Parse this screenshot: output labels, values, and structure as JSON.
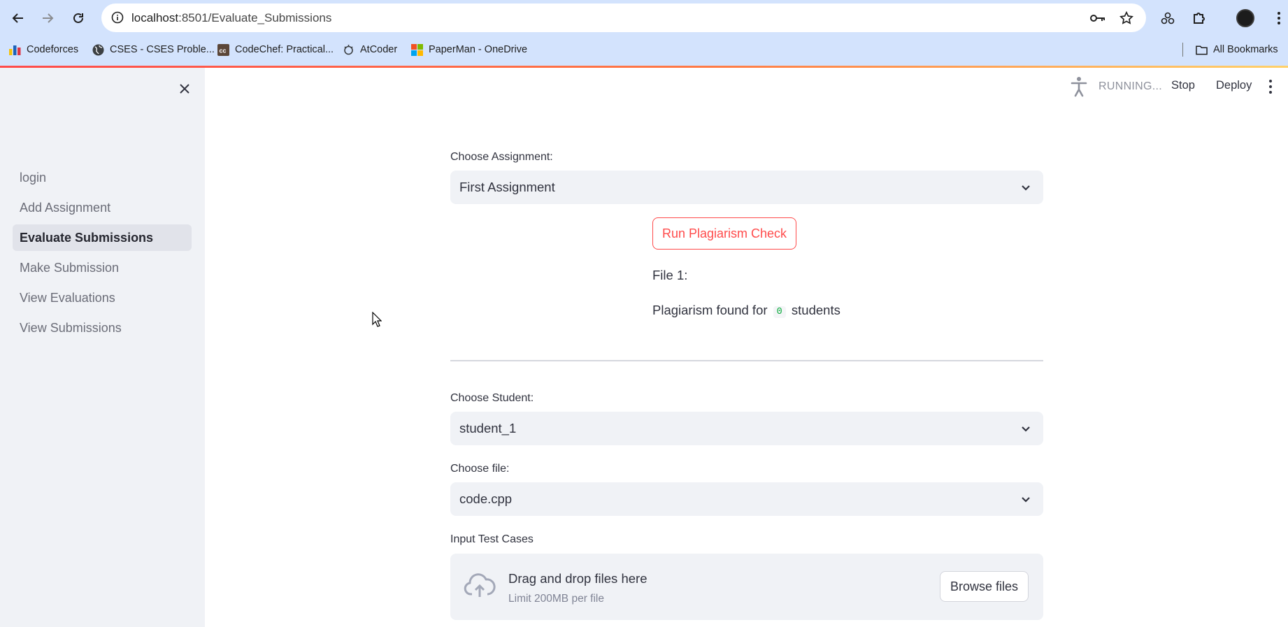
{
  "browser": {
    "url_host": "localhost",
    "url_path": ":8501/Evaluate_Submissions",
    "bookmarks": [
      {
        "label": "Codeforces",
        "icon": "codeforces-icon"
      },
      {
        "label": "CSES - CSES Proble...",
        "icon": "globe-icon"
      },
      {
        "label": "CodeChef: Practical...",
        "icon": "codechef-icon"
      },
      {
        "label": "AtCoder",
        "icon": "atcoder-icon"
      },
      {
        "label": "PaperMan - OneDrive",
        "icon": "microsoft-icon"
      }
    ],
    "all_bookmarks": "All Bookmarks"
  },
  "sidebar": {
    "items": [
      {
        "label": "login",
        "active": false
      },
      {
        "label": "Add Assignment",
        "active": false
      },
      {
        "label": "Evaluate Submissions",
        "active": true
      },
      {
        "label": "Make Submission",
        "active": false
      },
      {
        "label": "View Evaluations",
        "active": false
      },
      {
        "label": "View Submissions",
        "active": false
      }
    ]
  },
  "header": {
    "status": "RUNNING...",
    "stop": "Stop",
    "deploy": "Deploy"
  },
  "main": {
    "assignment_label": "Choose Assignment:",
    "assignment_value": "First Assignment",
    "run_button": "Run Plagiarism Check",
    "file_line": "File 1:",
    "plag_prefix": "Plagiarism found for",
    "plag_count": "0",
    "plag_suffix": "students",
    "student_label": "Choose Student:",
    "student_value": "student_1",
    "file_label": "Choose file:",
    "file_value": "code.cpp",
    "testcases_label": "Input Test Cases",
    "dropzone_title": "Drag and drop files here",
    "dropzone_limit": "Limit 200MB per file",
    "browse_button": "Browse files"
  },
  "colors": {
    "accent": "#ff4b4b",
    "sidebar_bg": "#f0f2f6",
    "chrome_bg": "#d3e3fd"
  }
}
